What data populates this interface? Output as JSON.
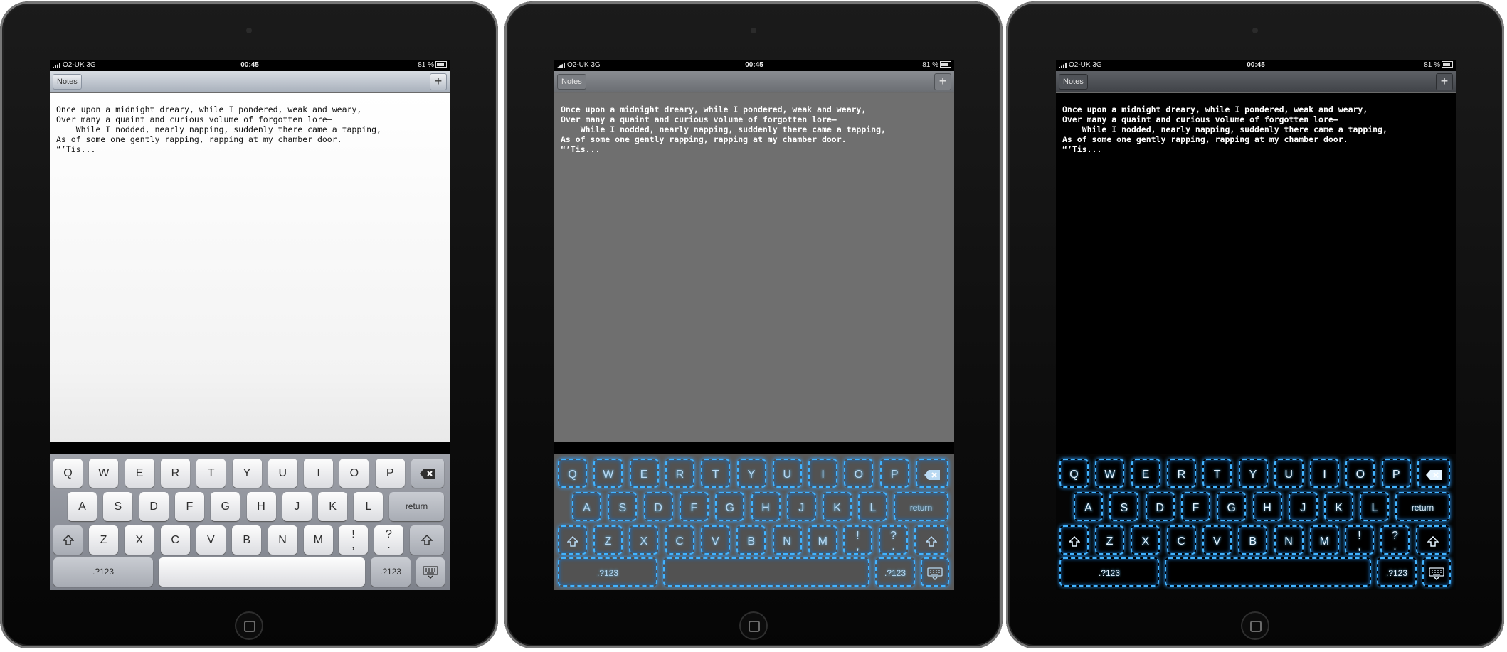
{
  "status": {
    "carrier": "O2-UK",
    "network": "3G",
    "time": "00:45",
    "battery": "81 %"
  },
  "nav": {
    "notes_label": "Notes",
    "add_label": "+"
  },
  "note": {
    "text": "Once upon a midnight dreary, while I pondered, weak and weary,\nOver many a quaint and curious volume of forgotten lore—\n    While I nodded, nearly napping, suddenly there came a tapping,\nAs of some one gently rapping, rapping at my chamber door.\n“’Tis..."
  },
  "keyboard": {
    "row1": [
      "Q",
      "W",
      "E",
      "R",
      "T",
      "Y",
      "U",
      "I",
      "O",
      "P"
    ],
    "row2": [
      "A",
      "S",
      "D",
      "F",
      "G",
      "H",
      "J",
      "K",
      "L"
    ],
    "row3": [
      "Z",
      "X",
      "C",
      "V",
      "B",
      "N",
      "M"
    ],
    "return_label": "return",
    "exclam_top": "!",
    "exclam_bottom": ",",
    "question_top": "?",
    "question_bottom": ".",
    "numbers_label": ".?123"
  },
  "themes": [
    "classic",
    "grey",
    "black"
  ],
  "colors": {
    "glow": "#43b4ff",
    "grey_bg": "#6f6f6f",
    "black_bg": "#000000"
  }
}
